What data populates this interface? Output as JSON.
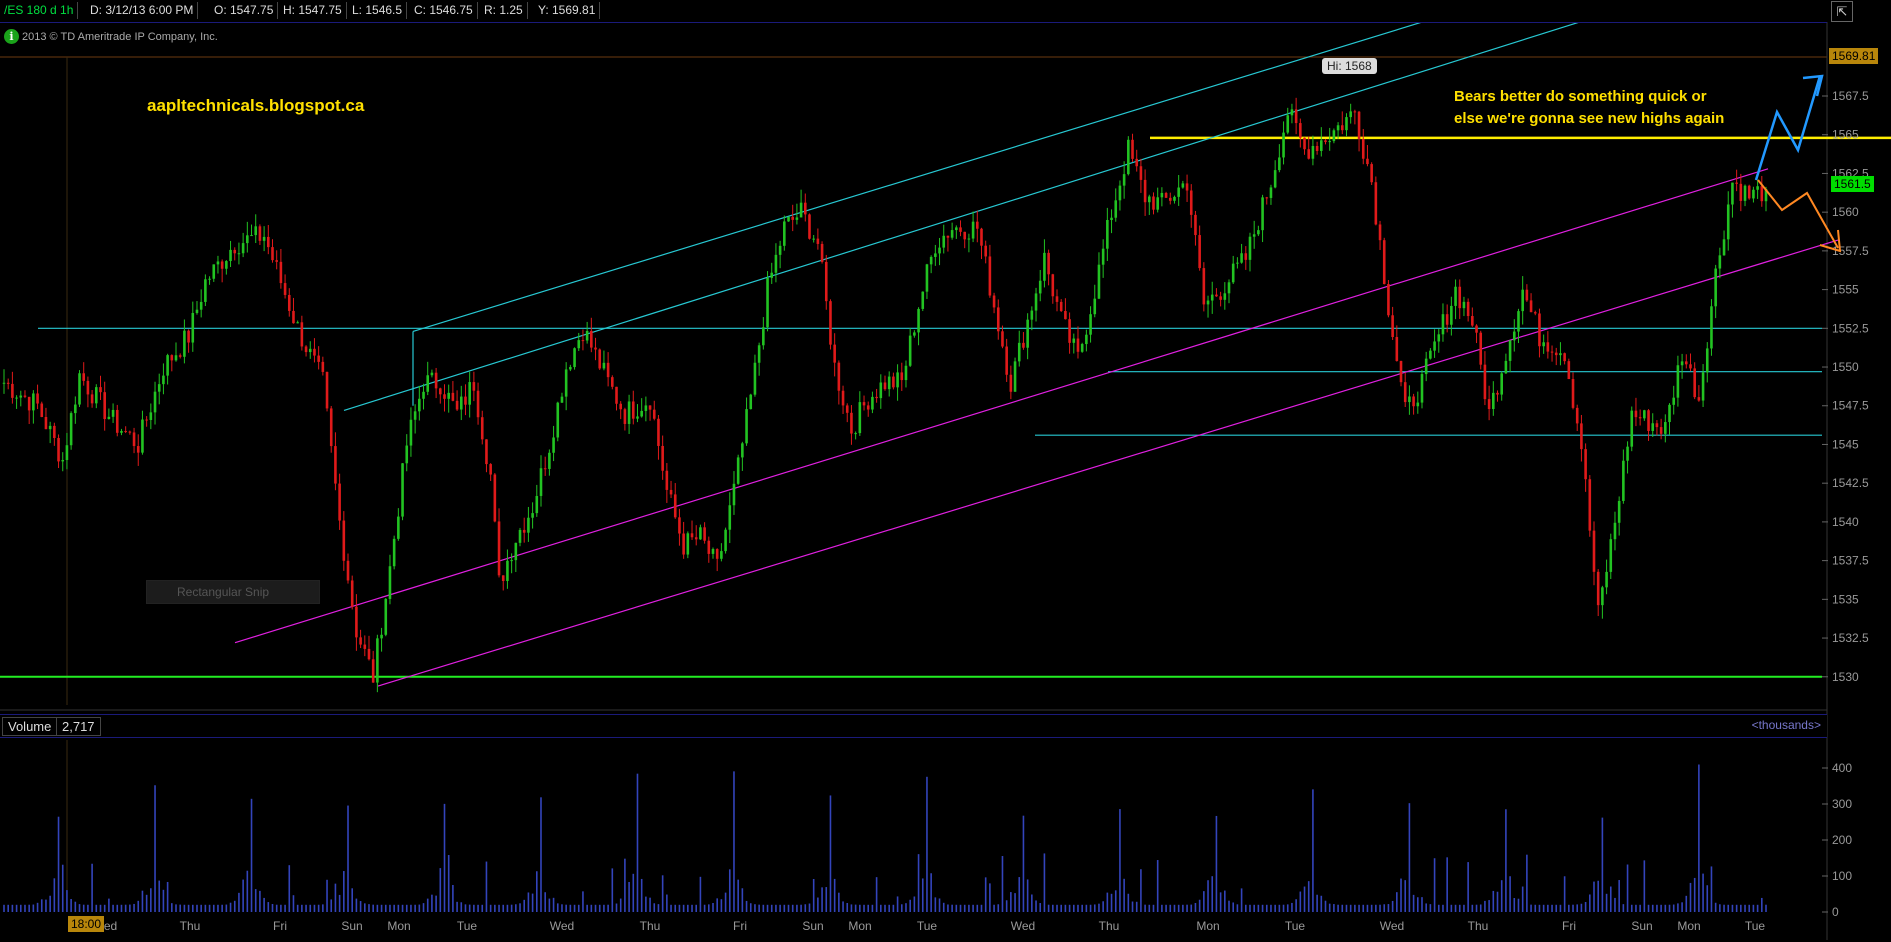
{
  "header": {
    "symbol": "/ES 180 d 1h",
    "date": "D: 3/12/13 6:00 PM",
    "open": "O: 1547.75",
    "high": "H: 1547.75",
    "low": "L: 1546.5",
    "close": "C: 1546.75",
    "range": "R: 1.25",
    "y": "Y: 1569.81",
    "corner_icon": "expand-icon"
  },
  "copyright": "2013 © TD Ameritrade IP Company, Inc.",
  "site_label": "aapltechnicals.blogspot.ca",
  "note_lines": [
    "Bears better do something quick or",
    "else we're gonna see new highs again"
  ],
  "snip_label": "Rectangular Snip",
  "hi_label": "Hi: 1568",
  "price_tags": {
    "top": "1569.81",
    "last": "1561.5"
  },
  "time_tag": "18:00",
  "volume_panel": {
    "label": "Volume",
    "value": "2,717",
    "units": "<thousands>"
  },
  "colors": {
    "up": "#22c322",
    "down": "#e01a1a",
    "cyan": "#27c8d2",
    "magenta": "#e020e0",
    "yellow": "#ffee00",
    "green": "#22ee22",
    "volume": "#3344bb",
    "blue_arrow": "#2299ff",
    "orange_arrow": "#ff8822"
  },
  "chart_data": {
    "type": "candlestick",
    "title": "",
    "y_ticks": [
      1567.5,
      1565,
      1562.5,
      1560,
      1557.5,
      1555,
      1552.5,
      1550,
      1547.5,
      1545,
      1542.5,
      1540,
      1537.5,
      1535,
      1532.5,
      1530
    ],
    "y_tick_labels": [
      "1567.5",
      "1565",
      "1562.5",
      "1560",
      "1557.5",
      "1555",
      "1552.5",
      "1550",
      "1547.5",
      "1545",
      "1542.5",
      "1540",
      "1537.5",
      "1535",
      "1532.5",
      "1530"
    ],
    "x_day_labels": [
      "Wed",
      "Thu",
      "Fri",
      "Sun",
      "Mon",
      "Tue",
      "Wed",
      "Thu",
      "Fri",
      "Sun",
      "Mon",
      "Tue",
      "Wed",
      "Thu",
      "Mon",
      "Tue",
      "Wed",
      "Thu",
      "Fri",
      "Sun",
      "Mon",
      "Tue"
    ],
    "ylim": [
      1528.5,
      1570.6
    ],
    "path_points": [
      [
        0,
        1549
      ],
      [
        8,
        1547.5
      ],
      [
        14,
        1544
      ],
      [
        18,
        1549.5
      ],
      [
        26,
        1546.5
      ],
      [
        32,
        1545
      ],
      [
        38,
        1550
      ],
      [
        44,
        1552
      ],
      [
        48,
        1555.5
      ],
      [
        55,
        1558
      ],
      [
        62,
        1558.5
      ],
      [
        66,
        1555.5
      ],
      [
        70,
        1552.5
      ],
      [
        76,
        1549
      ],
      [
        80,
        1540
      ],
      [
        84,
        1533
      ],
      [
        88,
        1530
      ],
      [
        92,
        1537
      ],
      [
        96,
        1545
      ],
      [
        100,
        1549
      ],
      [
        104,
        1549
      ],
      [
        108,
        1547
      ],
      [
        112,
        1549
      ],
      [
        116,
        1543
      ],
      [
        118,
        1536
      ],
      [
        122,
        1539
      ],
      [
        126,
        1541
      ],
      [
        130,
        1545
      ],
      [
        134,
        1550
      ],
      [
        138,
        1552.5
      ],
      [
        144,
        1549
      ],
      [
        148,
        1547
      ],
      [
        154,
        1548
      ],
      [
        158,
        1542
      ],
      [
        162,
        1538.5
      ],
      [
        166,
        1539
      ],
      [
        170,
        1537
      ],
      [
        174,
        1542
      ],
      [
        178,
        1548
      ],
      [
        182,
        1555
      ],
      [
        186,
        1559
      ],
      [
        190,
        1560
      ],
      [
        194,
        1558
      ],
      [
        198,
        1550
      ],
      [
        202,
        1546
      ],
      [
        206,
        1548
      ],
      [
        210,
        1549
      ],
      [
        214,
        1549
      ],
      [
        218,
        1554
      ],
      [
        222,
        1558
      ],
      [
        226,
        1559
      ],
      [
        232,
        1559
      ],
      [
        236,
        1554
      ],
      [
        240,
        1549
      ],
      [
        244,
        1553
      ],
      [
        248,
        1557
      ],
      [
        252,
        1553
      ],
      [
        256,
        1550.5
      ],
      [
        260,
        1555
      ],
      [
        264,
        1560
      ],
      [
        268,
        1564
      ],
      [
        272,
        1561
      ],
      [
        276,
        1560.5
      ],
      [
        282,
        1562
      ],
      [
        286,
        1554
      ],
      [
        290,
        1555
      ],
      [
        296,
        1557
      ],
      [
        302,
        1562
      ],
      [
        306,
        1566.5
      ],
      [
        310,
        1564
      ],
      [
        316,
        1565
      ],
      [
        322,
        1566.5
      ],
      [
        326,
        1562
      ],
      [
        330,
        1554
      ],
      [
        334,
        1547
      ],
      [
        338,
        1549
      ],
      [
        342,
        1552
      ],
      [
        346,
        1555
      ],
      [
        350,
        1553
      ],
      [
        354,
        1547
      ],
      [
        358,
        1551
      ],
      [
        362,
        1555
      ],
      [
        366,
        1552
      ],
      [
        372,
        1551
      ],
      [
        376,
        1545
      ],
      [
        380,
        1534
      ],
      [
        384,
        1540
      ],
      [
        388,
        1547
      ],
      [
        392,
        1546.5
      ],
      [
        396,
        1546
      ],
      [
        400,
        1551
      ],
      [
        404,
        1548
      ],
      [
        408,
        1556
      ],
      [
        412,
        1562
      ],
      [
        416,
        1561
      ],
      [
        420,
        1561.5
      ]
    ],
    "volume_ylim": [
      0,
      450
    ],
    "volume_ticks": [
      400,
      300,
      200,
      100,
      0
    ]
  }
}
